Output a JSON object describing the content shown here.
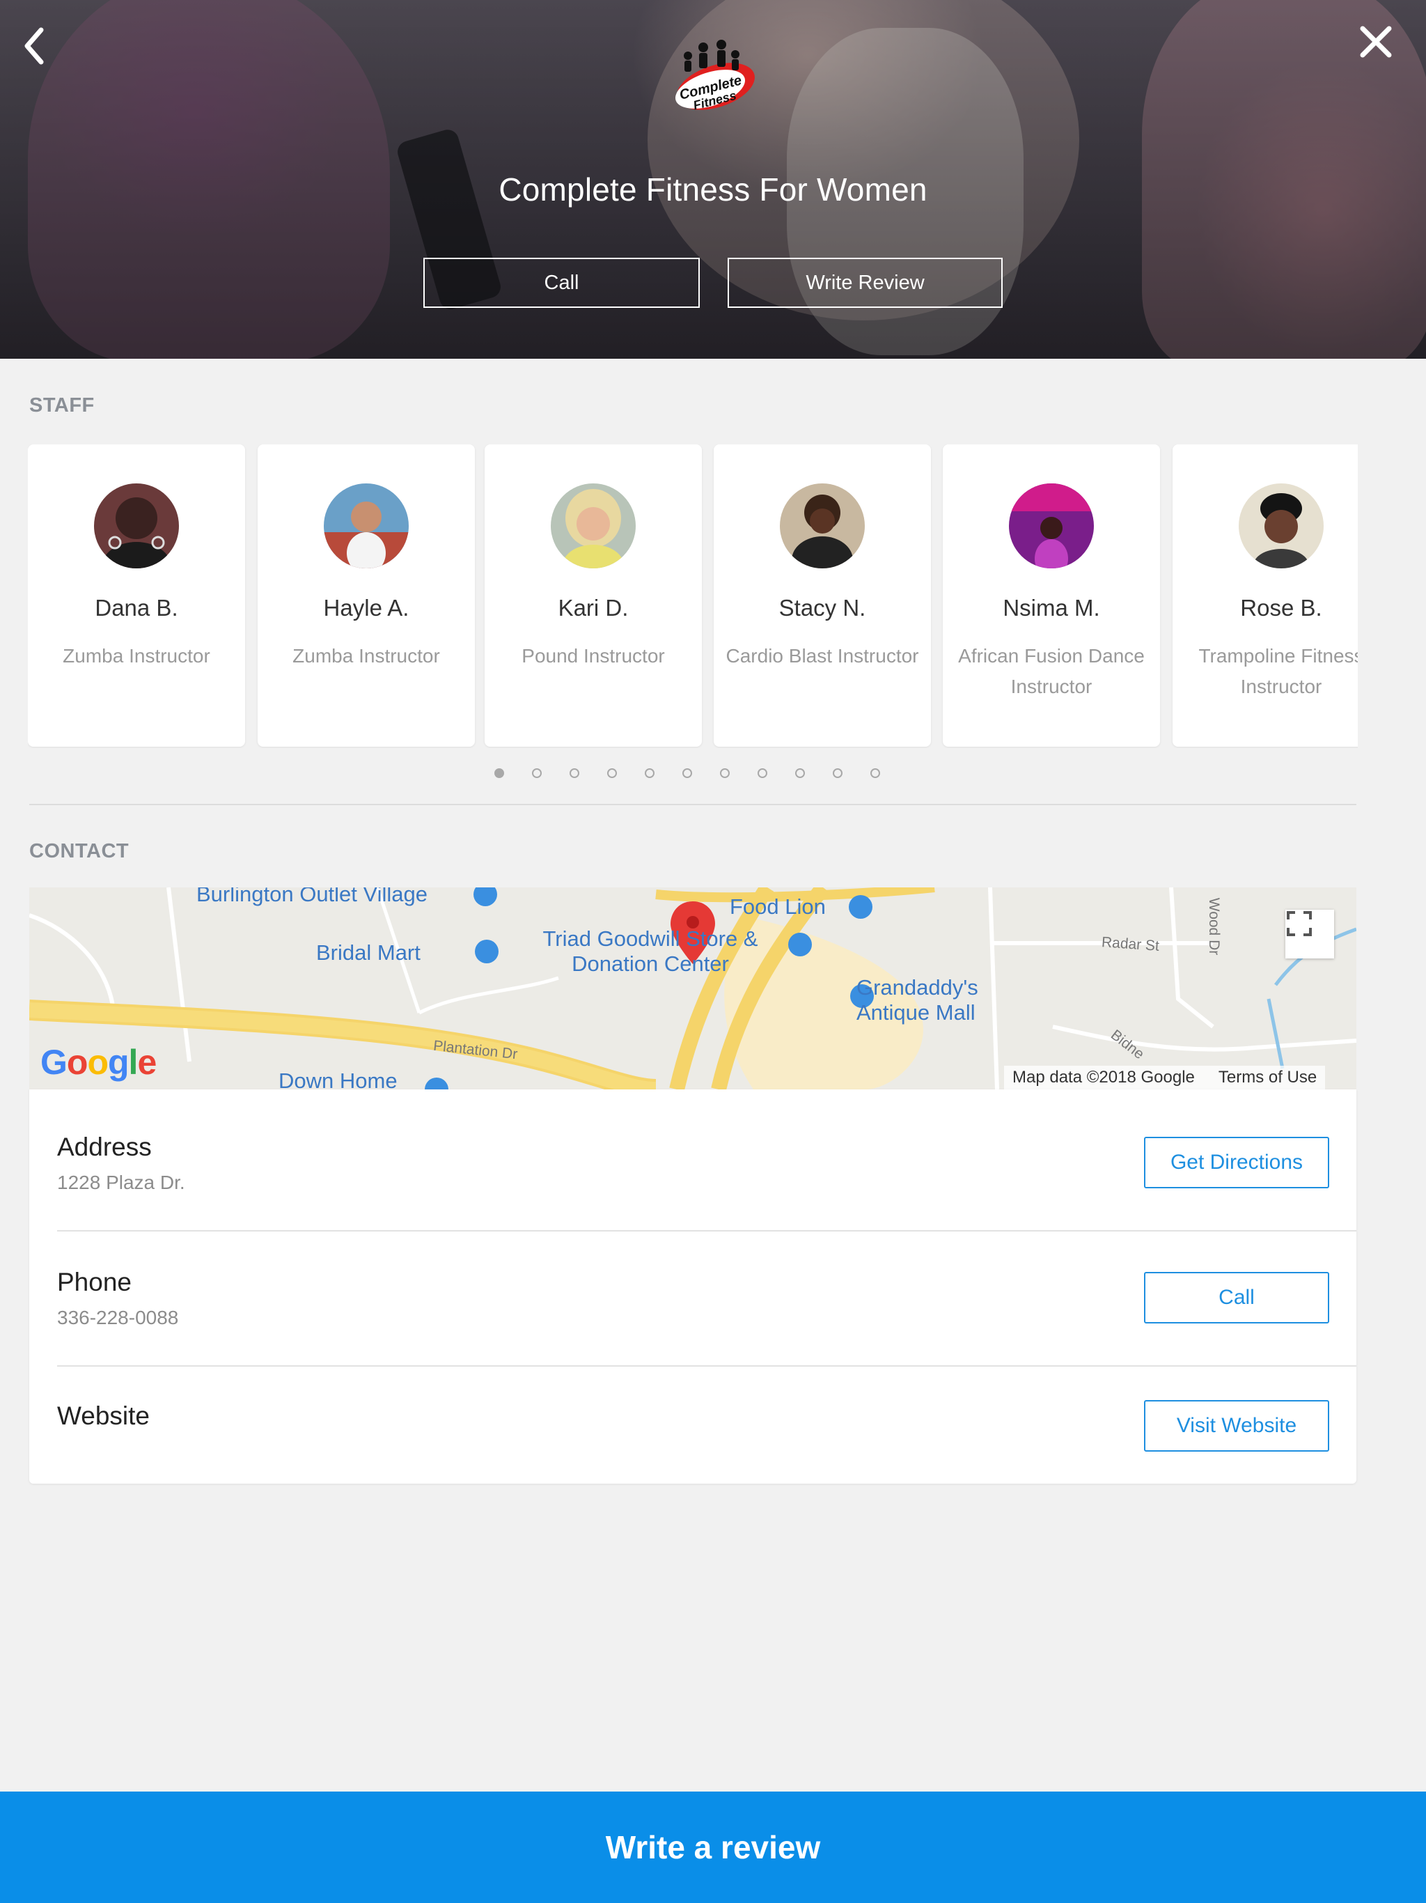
{
  "header": {
    "title": "Complete Fitness For Women",
    "call_label": "Call",
    "review_label": "Write Review",
    "logo_text": "Complete Fitness"
  },
  "staff": {
    "heading": "STAFF",
    "members": [
      {
        "name": "Dana B.",
        "role": "Zumba Instructor"
      },
      {
        "name": "Hayle A.",
        "role": "Zumba Instructor"
      },
      {
        "name": "Kari D.",
        "role": "Pound Instructor"
      },
      {
        "name": "Stacy N.",
        "role": "Cardio Blast Instructor"
      },
      {
        "name": "Nsima M.",
        "role": "African Fusion Dance Instructor"
      },
      {
        "name": "Rose B.",
        "role": "Trampoline Fitness Instructor"
      }
    ],
    "pagination": {
      "total": 11,
      "current": 1
    }
  },
  "contact": {
    "heading": "CONTACT",
    "map": {
      "places": [
        "Burlington Outlet Village",
        "Food Lion",
        "Bridal Mart",
        "Triad Goodwill Store & Donation Center",
        "Grandaddy's Antique Mall",
        "Down Home"
      ],
      "roads": [
        "Plantation Dr",
        "Radar St",
        "Wood Dr",
        "Bidne"
      ],
      "attribution": "Map data ©2018 Google",
      "terms": "Terms of Use",
      "logo": "Google"
    },
    "address": {
      "label": "Address",
      "value": "1228 Plaza Dr.",
      "button": "Get Directions"
    },
    "phone": {
      "label": "Phone",
      "value": "336-228-0088",
      "button": "Call"
    },
    "website": {
      "label": "Website",
      "button": "Visit Website"
    }
  },
  "footer": {
    "cta_label": "Write a review"
  },
  "colors": {
    "accent": "#1e8fe0",
    "cta_background": "#0a8ee8",
    "page_background": "#f1f1f1",
    "map_pin": "#e53935"
  }
}
